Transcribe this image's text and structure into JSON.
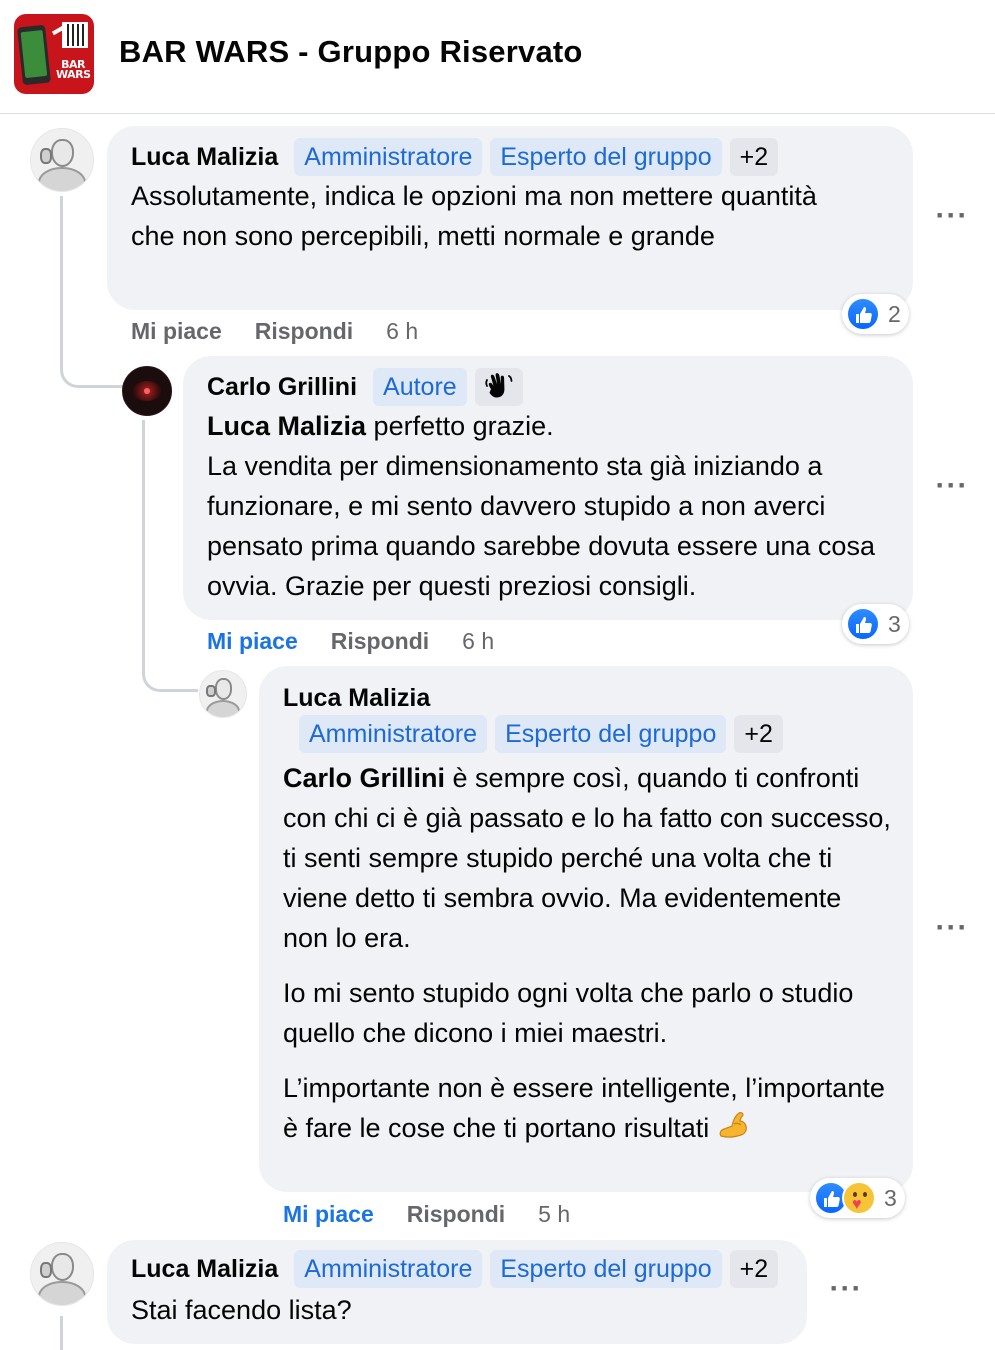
{
  "header": {
    "group_title": "BAR WARS - Gruppo Riservato",
    "thumb_text": "BAR WARS"
  },
  "comments": [
    {
      "author": "Luca Malizia",
      "badges": [
        "Amministratore",
        "Esperto del gruppo",
        "+2"
      ],
      "text": "Assolutamente, indica le opzioni ma non mettere quantità che non sono percepibili, metti normale e grande",
      "like_label": "Mi piace",
      "reply_label": "Rispondi",
      "time": "6 h",
      "reaction_count": "2",
      "liked": false
    },
    {
      "author": "Carlo Grillini",
      "badges": [
        "Autore"
      ],
      "mention": "Luca Malizia",
      "text_after_mention": " perfetto grazie.",
      "text": "La vendita per dimensionamento sta già iniziando a funzionare, e mi sento davvero stupido a non averci pensato prima quando sarebbe dovuta essere una cosa ovvia. Grazie per questi preziosi consigli.",
      "like_label": "Mi piace",
      "reply_label": "Rispondi",
      "time": "6 h",
      "reaction_count": "3",
      "liked": true
    },
    {
      "author": "Luca Malizia",
      "badges": [
        "Amministratore",
        "Esperto del gruppo",
        "+2"
      ],
      "mention": "Carlo Grillini",
      "text_after_mention": " è sempre così, quando ti confronti con chi ci è già passato e lo ha fatto con successo, ti senti sempre stupido perché una volta che ti viene detto ti sembra ovvio. Ma evidentemente non lo era.",
      "paragraph2": "Io mi sento stupido ogni volta che parlo o studio quello che dicono i miei maestri.",
      "paragraph3": "L’importante non è essere intelligente, l’importante è fare le cose che ti portano risultati",
      "like_label": "Mi piace",
      "reply_label": "Rispondi",
      "time": "5 h",
      "reaction_count": "3",
      "liked": true
    },
    {
      "author": "Luca Malizia",
      "badges": [
        "Amministratore",
        "Esperto del gruppo",
        "+2"
      ],
      "text": "Stai facendo lista?"
    }
  ],
  "icons": {
    "more": "more-options-icon",
    "like": "like-reaction-icon",
    "care": "care-reaction-icon",
    "wave": "waving-hand-icon",
    "muscle": "flexed-biceps-icon"
  },
  "colors": {
    "accent": "#1b74e4",
    "badge_bg": "#dfe8f6",
    "bubble": "#f0f2f5"
  }
}
